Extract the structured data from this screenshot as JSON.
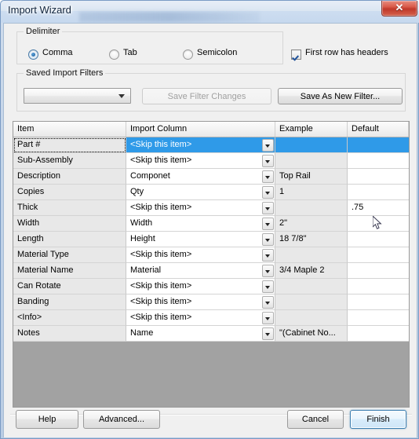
{
  "window": {
    "title": "Import Wizard",
    "close_icon": "close-icon",
    "close_glyph": "✕"
  },
  "delimiter_group": {
    "label": "Delimiter",
    "options": [
      {
        "label": "Comma",
        "checked": true
      },
      {
        "label": "Tab",
        "checked": false
      },
      {
        "label": "Semicolon",
        "checked": false
      }
    ]
  },
  "first_row_headers": {
    "label": "First row has headers",
    "checked": true
  },
  "saved_filters_group": {
    "label": "Saved Import Filters",
    "combo": {
      "value": "",
      "arrow_icon": "chevron-down-icon"
    },
    "save_changes_button": {
      "label": "Save Filter Changes",
      "enabled": false
    },
    "save_new_button": {
      "label": "Save As New Filter...",
      "enabled": true
    }
  },
  "grid": {
    "columns": [
      "Item",
      "Import Column",
      "Example",
      "Default"
    ],
    "selected_row_index": 0,
    "rows": [
      {
        "item": "Part #",
        "import_column": "<Skip this item>",
        "example": "",
        "default": ""
      },
      {
        "item": "Sub-Assembly",
        "import_column": "<Skip this item>",
        "example": "",
        "default": ""
      },
      {
        "item": "Description",
        "import_column": "Componet",
        "example": "Top Rail",
        "default": ""
      },
      {
        "item": "Copies",
        "import_column": "Qty",
        "example": "1",
        "default": ""
      },
      {
        "item": "Thick",
        "import_column": "<Skip this item>",
        "example": "",
        "default": ".75"
      },
      {
        "item": "Width",
        "import_column": "Width",
        "example": "2\"",
        "default": ""
      },
      {
        "item": "Length",
        "import_column": "Height",
        "example": "18 7/8\"",
        "default": ""
      },
      {
        "item": "Material Type",
        "import_column": "<Skip this item>",
        "example": "",
        "default": ""
      },
      {
        "item": "Material Name",
        "import_column": "Material",
        "example": "3/4 Maple 2",
        "default": ""
      },
      {
        "item": "Can Rotate",
        "import_column": "<Skip this item>",
        "example": "",
        "default": ""
      },
      {
        "item": "Banding",
        "import_column": "<Skip this item>",
        "example": "",
        "default": ""
      },
      {
        "item": "<Info>",
        "import_column": "<Skip this item>",
        "example": "",
        "default": ""
      },
      {
        "item": "Notes",
        "import_column": "Name",
        "example": "\"(Cabinet No...",
        "default": ""
      }
    ]
  },
  "footer": {
    "help_label": "Help",
    "advanced_label": "Advanced...",
    "cancel_label": "Cancel",
    "finish_label": "Finish"
  },
  "colors": {
    "selection_blue": "#2f9ae8",
    "close_red": "#c0392a",
    "default_button_border": "#3c7fb1",
    "grid_empty_gray": "#a2a2a2"
  }
}
